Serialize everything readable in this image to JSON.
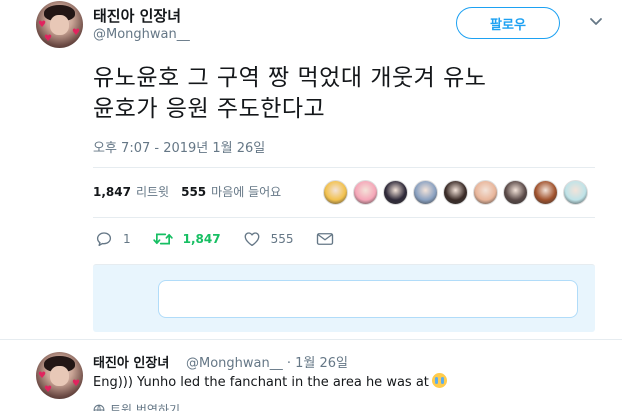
{
  "tweet": {
    "display_name": "태진아 인장녀",
    "handle": "@Monghwan__",
    "follow_label": "팔로우",
    "text_line1": "유노윤호 그 구역 짱 먹었대 개웃겨 유노",
    "text_line2": "윤호가 응원 주도한다고",
    "timestamp": "오후 7:07 - 2019년 1월 26일",
    "retweets_count": "1,847",
    "retweets_label": "리트윗",
    "likes_count": "555",
    "likes_label": "마음에 들어요",
    "actions": {
      "reply_count": "1",
      "retweet_count": "1,847",
      "like_count": "555"
    }
  },
  "liker_colors": [
    "#f2c14e",
    "#f5a6b8",
    "#2f2a3a",
    "#8aa1c1",
    "#3b2c28",
    "#e8b59a",
    "#5a4a48",
    "#a0522d",
    "#bfe3e8"
  ],
  "reply_box": {
    "placeholder": ""
  },
  "reply": {
    "display_name": "태진아 인장녀",
    "meta": "@Monghwan__ · 1월 26일",
    "text": "Eng))) Yunho led the fanchant in the area he was at",
    "translate_label": "트윗 번역하기"
  },
  "colors": {
    "accent": "#1da1f2",
    "retweet_green": "#17bf63",
    "muted": "#657786"
  }
}
